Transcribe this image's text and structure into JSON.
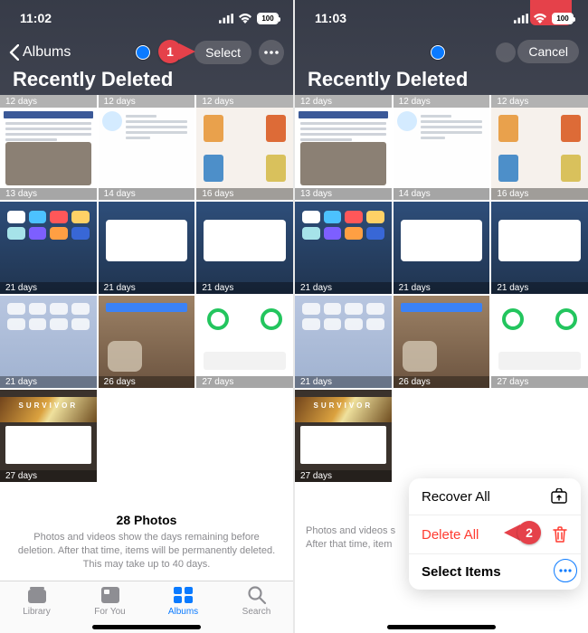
{
  "left": {
    "status": {
      "time": "11:02",
      "battery": "100"
    },
    "nav": {
      "back_label": "Albums",
      "select_label": "Select"
    },
    "title": "Recently Deleted",
    "strip": [
      "12 days",
      "12 days",
      "12 days"
    ],
    "rows": [
      [
        {
          "badge": "13 days"
        },
        {
          "badge": "14 days"
        },
        {
          "badge": "16 days"
        }
      ],
      [
        {
          "badge": "21 days"
        },
        {
          "badge": "21 days"
        },
        {
          "badge": "21 days"
        }
      ],
      [
        {
          "badge": "21 days"
        },
        {
          "badge": "26 days"
        },
        {
          "badge": "27 days"
        }
      ],
      [
        {
          "badge": "27 days"
        },
        null,
        null
      ]
    ],
    "survivor_text": "SURVIVOR",
    "footer": {
      "count": "28 Photos",
      "desc": "Photos and videos show the days remaining before deletion. After that time, items will be permanently deleted. This may take up to 40 days."
    },
    "tabs": {
      "library": "Library",
      "foryou": "For You",
      "albums": "Albums",
      "search": "Search"
    },
    "marker": "1"
  },
  "right": {
    "status": {
      "time": "11:03",
      "battery": "100"
    },
    "nav": {
      "cancel_label": "Cancel"
    },
    "title": "Recently Deleted",
    "strip": [
      "12 days",
      "12 days",
      "12 days"
    ],
    "rows": [
      [
        {
          "badge": "13 days"
        },
        {
          "badge": "14 days"
        },
        {
          "badge": "16 days"
        }
      ],
      [
        {
          "badge": "21 days"
        },
        {
          "badge": "21 days"
        },
        {
          "badge": "21 days"
        }
      ],
      [
        {
          "badge": "21 days"
        },
        {
          "badge": "26 days"
        },
        {
          "badge": "27 days"
        }
      ],
      [
        {
          "badge": "27 days"
        },
        null,
        null
      ]
    ],
    "survivor_text": "SURVIVOR",
    "footer_partial": "Photos and videos s\nAfter that time, item",
    "sheet": {
      "recover": "Recover All",
      "delete": "Delete All",
      "select": "Select Items"
    },
    "marker": "2"
  }
}
